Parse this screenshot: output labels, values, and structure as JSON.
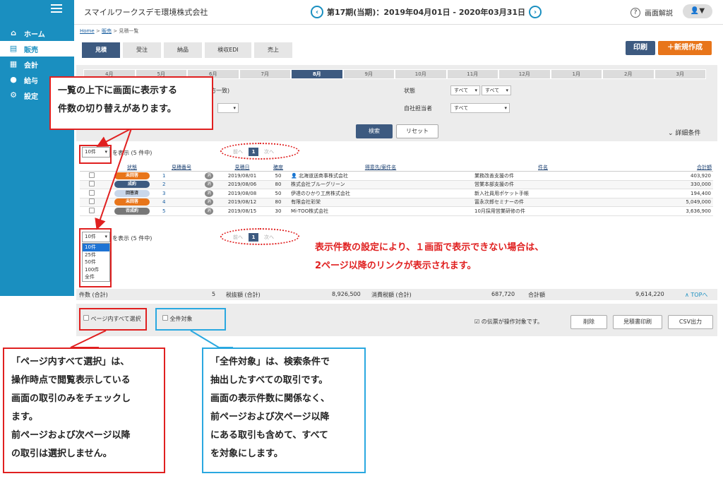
{
  "sidebar": {
    "items": [
      {
        "label": "ホーム",
        "icon": "home-icon",
        "glyph": "⌂"
      },
      {
        "label": "販売",
        "icon": "cart-icon",
        "glyph": "🛒"
      },
      {
        "label": "会計",
        "icon": "calculator-icon",
        "glyph": "▦"
      },
      {
        "label": "給与",
        "icon": "moneybag-icon",
        "glyph": "●"
      },
      {
        "label": "設定",
        "icon": "gear-icon",
        "glyph": "⚙"
      }
    ]
  },
  "header": {
    "company": "スマイルワークスデモ環境株式会社",
    "period": "第17期(当期)：2019年04月01日 - 2020年03月31日",
    "prev": "‹",
    "next": "›",
    "help": "画面解説",
    "user": "▼"
  },
  "breadcrumb": {
    "home": "Home",
    "sales": "販売",
    "current": "見積一覧"
  },
  "tabs": [
    "見積",
    "受注",
    "納品",
    "検収EDI",
    "売上"
  ],
  "actions": {
    "print": "印刷",
    "new": "＋新規作成"
  },
  "months": [
    "4月",
    "5月",
    "6月",
    "7月",
    "8月",
    "9月",
    "10月",
    "11月",
    "12月",
    "1月",
    "2月",
    "3月"
  ],
  "search": {
    "partial_label": "方一致)",
    "status_label": "状態",
    "status_val1": "すべて",
    "status_val2": "すべて",
    "owner_label": "自社担当者",
    "owner_val": "すべて",
    "search_btn": "検索",
    "reset_btn": "リセット",
    "detail": "詳細条件"
  },
  "list": {
    "pagesize_top": "10件",
    "pagesize_bottom": "10件",
    "count_top": "を表示 (5 件中)",
    "count_bottom": "を表示 (5 件中)",
    "prev": "前へ",
    "next": "次へ",
    "page": "1",
    "options": [
      "10件",
      "25件",
      "50件",
      "100件",
      "全件"
    ]
  },
  "table": {
    "headers": [
      "状態",
      "見積番号",
      "",
      "見積日",
      "確度",
      "得意先/案件名",
      "件名",
      "合計額"
    ],
    "rows": [
      {
        "status": "未回答",
        "color": "#e8751a",
        "no": "1",
        "date": "2019/08/01",
        "prob": "50",
        "client": "北海道送商事株式会社",
        "subject": "業務改善支援の件",
        "total": "403,920"
      },
      {
        "status": "成約",
        "color": "#3d5a80",
        "no": "2",
        "date": "2019/08/06",
        "prob": "80",
        "client": "株式会社ブルーグリーン",
        "subject": "営業本部支援の件",
        "total": "330,000"
      },
      {
        "status": "回答済",
        "color": "#c9d7ea",
        "no": "3",
        "date": "2019/08/08",
        "prob": "50",
        "client": "伊達のひかり工房株式会社",
        "subject": "新入社員用ポケット手帳",
        "total": "194,400"
      },
      {
        "status": "未回答",
        "color": "#e8751a",
        "no": "4",
        "date": "2019/08/12",
        "prob": "80",
        "client": "有限会社彩栄",
        "subject": "冨永次郎セミナーの件",
        "total": "5,049,000"
      },
      {
        "status": "否成約",
        "color": "#777777",
        "no": "5",
        "date": "2019/08/15",
        "prob": "30",
        "client": "Mi-TOO株式会社",
        "subject": "10月採用営業研修の件",
        "total": "3,636,900"
      }
    ],
    "kesi": "消"
  },
  "totals": {
    "count_label": "件数 (合計)",
    "count": "5",
    "net_label": "税抜額 (合計)",
    "net": "8,926,500",
    "tax_label": "消費税額 (合計)",
    "tax": "687,720",
    "sum_label": "合計額",
    "sum": "9,614,220",
    "top": "∧ TOPへ"
  },
  "footer": {
    "select_page": "ページ内すべて選択",
    "select_all": "全件対象",
    "target_note": "☑ の伝票が操作対象です。",
    "delete": "削除",
    "print_quote": "見積書印刷",
    "csv": "CSV出力"
  },
  "annotations": {
    "top_note": [
      "一覧の上下に画面に表示する",
      "件数の切り替えがあります。"
    ],
    "mid_note": [
      "表示件数の設定により、１画面で表示できない場合は、",
      "2ページ以降のリンクが表示されます。"
    ],
    "bottom_left": [
      "「ページ内すべて選択」は、",
      "操作時点で閲覧表示している",
      "画面の取引のみをチェックし",
      "ます。",
      "前ページおよび次ページ以降",
      "の取引は選択しません。"
    ],
    "bottom_right": [
      "「全件対象」は、検索条件で",
      "抽出したすべての取引です。",
      "画面の表示件数に関係なく、",
      "前ページおよび次ページ以降",
      "にある取引も含めて、すべて",
      "を対象にします。"
    ]
  },
  "colors": {
    "sidebar": "#1a8fc0",
    "primary": "#3d5a80",
    "accent": "#e8751a",
    "annotation_red": "#e02020",
    "annotation_blue": "#2aa8e0"
  }
}
